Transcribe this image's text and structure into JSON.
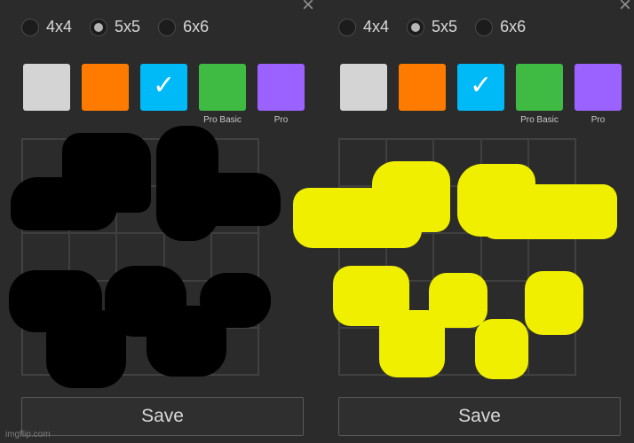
{
  "size_options": [
    "4x4",
    "5x5",
    "6x6"
  ],
  "selected_size": "5x5",
  "colors": [
    {
      "name": "light-gray",
      "hex": "#d4d4d4",
      "label": ""
    },
    {
      "name": "orange",
      "hex": "#fe7b00",
      "label": ""
    },
    {
      "name": "sky-blue",
      "hex": "#00baf7",
      "label": "",
      "selected": true
    },
    {
      "name": "green",
      "hex": "#3fbb43",
      "label": "Pro Basic"
    },
    {
      "name": "purple",
      "hex": "#9c62ff",
      "label": "Pro"
    }
  ],
  "panels": {
    "left": {
      "opt": {
        "a": "4x4",
        "b": "5x5",
        "c": "6x6"
      },
      "labels": {
        "pro_basic": "Pro Basic",
        "pro": "Pro"
      },
      "save": "Save"
    },
    "right": {
      "opt": {
        "a": "4x4",
        "b": "5x5",
        "c": "6x6"
      },
      "labels": {
        "pro_basic": "Pro Basic",
        "pro": "Pro"
      },
      "save": "Save"
    }
  },
  "close_glyph": "×",
  "check_glyph": "✓",
  "watermark": "imgflip.com",
  "scribble_colors": {
    "left": "#000000",
    "right": "#f1ef00"
  }
}
